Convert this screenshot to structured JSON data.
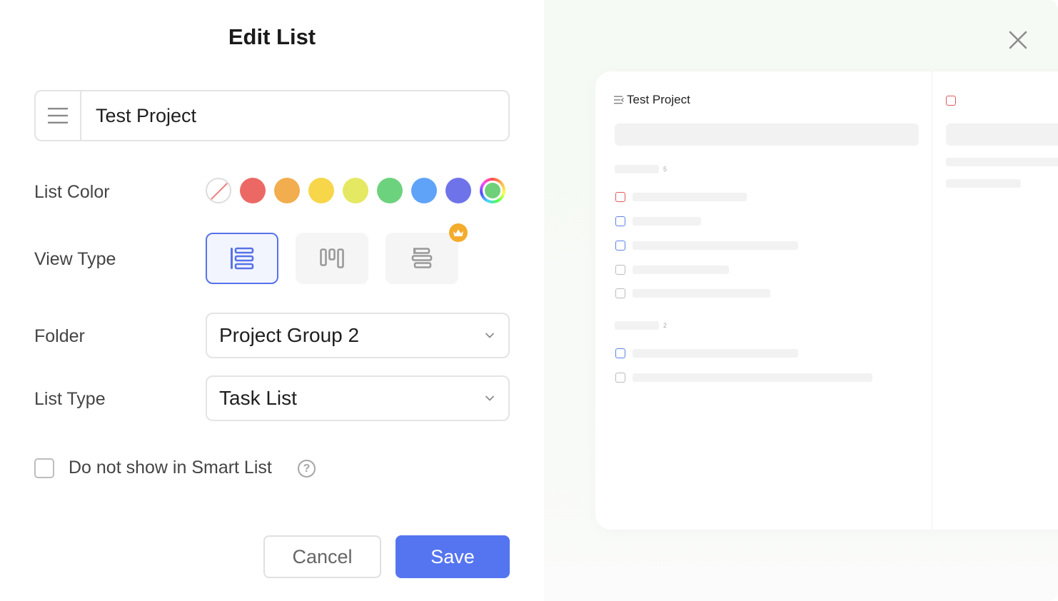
{
  "dialog": {
    "title": "Edit List",
    "name_field": {
      "value": "Test Project",
      "icon": "list-menu-icon"
    },
    "list_color": {
      "label": "List Color",
      "swatches": [
        "none",
        "#ec6865",
        "#f2ad4e",
        "#f7d64a",
        "#e5e862",
        "#6dd27e",
        "#5fa3f9",
        "#6f73ea",
        "custom"
      ]
    },
    "view_type": {
      "label": "View Type",
      "options": [
        {
          "icon": "list-view-icon",
          "selected": true
        },
        {
          "icon": "kanban-view-icon",
          "selected": false
        },
        {
          "icon": "timeline-view-icon",
          "selected": false,
          "premium": true
        }
      ]
    },
    "folder": {
      "label": "Folder",
      "value": "Project Group 2"
    },
    "list_type": {
      "label": "List Type",
      "value": "Task List"
    },
    "smart_list": {
      "label": "Do not show in Smart List",
      "checked": false
    },
    "buttons": {
      "cancel": "Cancel",
      "save": "Save"
    }
  },
  "preview": {
    "title": "Test Project",
    "section1_count": "5",
    "section2_count": "2"
  },
  "colors": {
    "accent": "#5575f0",
    "selected_border": "#5673e8",
    "crown": "#f4ac2c"
  }
}
